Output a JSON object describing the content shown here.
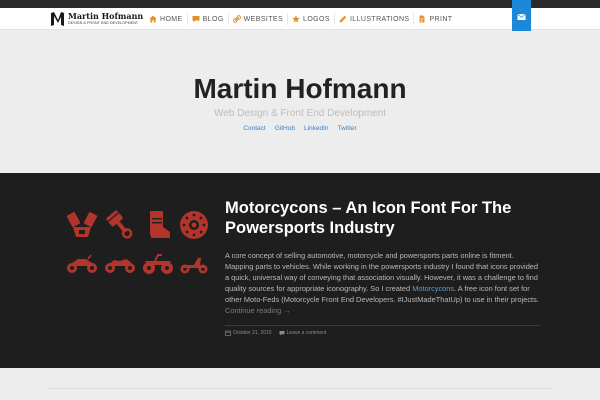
{
  "site": {
    "logo_name": "Martin Hofmann",
    "logo_tagline": "DESIGN & FRONT END DEVELOPMENT"
  },
  "nav": {
    "items": [
      {
        "label": "HOME",
        "icon": "home-icon"
      },
      {
        "label": "BLOG",
        "icon": "comment-icon"
      },
      {
        "label": "WEBSITES",
        "icon": "link-icon"
      },
      {
        "label": "LOGOS",
        "icon": "star-icon"
      },
      {
        "label": "ILLUSTRATIONS",
        "icon": "pencil-icon"
      },
      {
        "label": "PRINT",
        "icon": "document-icon"
      }
    ]
  },
  "hero": {
    "title": "Martin Hofmann",
    "subtitle": "Web Design & Front End Development",
    "links": [
      "Contact",
      "GitHub",
      "LinkedIn",
      "Twitter"
    ]
  },
  "post": {
    "title": "Motorcycons – An Icon Font For The Powersports Industry",
    "body_intro": "A core concept of selling automotive, motorcycle and powersports parts online is fitment. Mapping parts to vehicles. While working in the powersports industry I found that icons provided a quick, universal way of conveying that association visually. However, it was a challenge to find quality sources for appropriate iconography. So I created ",
    "body_link": "Motorcycons",
    "body_rest": ". A free icon font set for other Moto-Feds (Motorcycle Front End Developers. #IJustMadeThatUp) to use in their projects. ",
    "continue_label": "Continue reading",
    "date": "October 21, 2015",
    "comment_label": "Leave a comment"
  },
  "colors": {
    "accent_blue": "#3a82c4",
    "icon_red": "#b2352c",
    "nav_icon_orange": "#e0922a",
    "dark_bg": "#1e1e1e"
  }
}
